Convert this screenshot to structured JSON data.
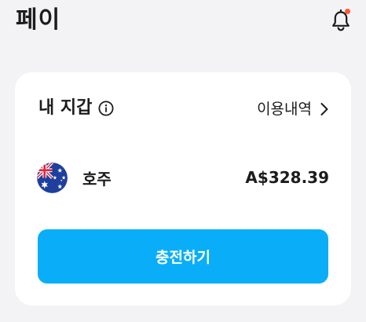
{
  "header": {
    "title": "페이",
    "notification_icon": "bell-icon",
    "notification_badge_color": "#ff5a36"
  },
  "wallet": {
    "title": "내 지갑",
    "info_icon": "info-icon",
    "history_label": "이용내역",
    "history_icon": "chevron-right-icon",
    "currency": {
      "flag_icon": "australia-flag-icon",
      "name": "호주",
      "amount": "A$328.39"
    },
    "charge_button_label": "충전하기"
  },
  "colors": {
    "background": "#f3f3f6",
    "card": "#ffffff",
    "accent": "#0aaef8",
    "text": "#1c1c1e"
  }
}
